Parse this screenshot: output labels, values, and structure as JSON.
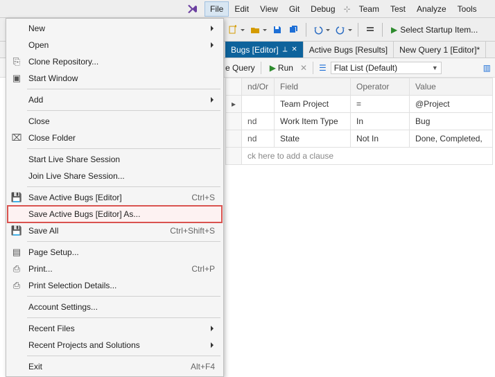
{
  "menubar": {
    "items": [
      "File",
      "Edit",
      "View",
      "Git",
      "Debug",
      "Team",
      "Test",
      "Analyze",
      "Tools"
    ]
  },
  "toolbar": {
    "startup_label": "Select Startup Item..."
  },
  "tabs": [
    {
      "label": "Bugs [Editor]",
      "active": true,
      "pinned": true,
      "closeable": true
    },
    {
      "label": "Active Bugs [Results]",
      "active": false
    },
    {
      "label": "New Query 1 [Editor]*",
      "active": false
    }
  ],
  "query_toolbar": {
    "query_fragment": "e Query",
    "run_label": "Run",
    "flatlist_label": "Flat List (Default)"
  },
  "grid": {
    "headers": [
      "",
      "nd/Or",
      "Field",
      "Operator",
      "Value"
    ],
    "rows": [
      {
        "andor": "",
        "field": "Team Project",
        "op": "=",
        "val": "@Project"
      },
      {
        "andor": "nd",
        "field": "Work Item Type",
        "op": "In",
        "val": "Bug"
      },
      {
        "andor": "nd",
        "field": "State",
        "op": "Not In",
        "val": "Done, Completed,"
      }
    ],
    "add_clause": "ck here to add a clause"
  },
  "file_menu": {
    "items": [
      {
        "label": "New",
        "sub": true
      },
      {
        "label": "Open",
        "sub": true
      },
      {
        "label": "Clone Repository...",
        "icon": "clone-icon"
      },
      {
        "label": "Start Window",
        "icon": "window-icon"
      },
      {
        "sep": true
      },
      {
        "label": "Add",
        "sub": true
      },
      {
        "sep": true
      },
      {
        "label": "Close"
      },
      {
        "label": "Close Folder",
        "icon": "close-folder-icon"
      },
      {
        "sep": true
      },
      {
        "label": "Start Live Share Session"
      },
      {
        "label": "Join Live Share Session..."
      },
      {
        "sep": true
      },
      {
        "label": "Save Active Bugs [Editor]",
        "shortcut": "Ctrl+S",
        "icon": "save-icon"
      },
      {
        "label": "Save Active Bugs [Editor] As...",
        "highlight": true
      },
      {
        "label": "Save All",
        "shortcut": "Ctrl+Shift+S",
        "icon": "save-all-icon"
      },
      {
        "sep": true
      },
      {
        "label": "Page Setup...",
        "icon": "page-setup-icon"
      },
      {
        "label": "Print...",
        "shortcut": "Ctrl+P",
        "icon": "print-icon"
      },
      {
        "label": "Print Selection Details...",
        "icon": "print-sel-icon"
      },
      {
        "sep": true
      },
      {
        "label": "Account Settings..."
      },
      {
        "sep": true
      },
      {
        "label": "Recent Files",
        "sub": true
      },
      {
        "label": "Recent Projects and Solutions",
        "sub": true
      },
      {
        "sep": true
      },
      {
        "label": "Exit",
        "shortcut": "Alt+F4"
      }
    ]
  }
}
